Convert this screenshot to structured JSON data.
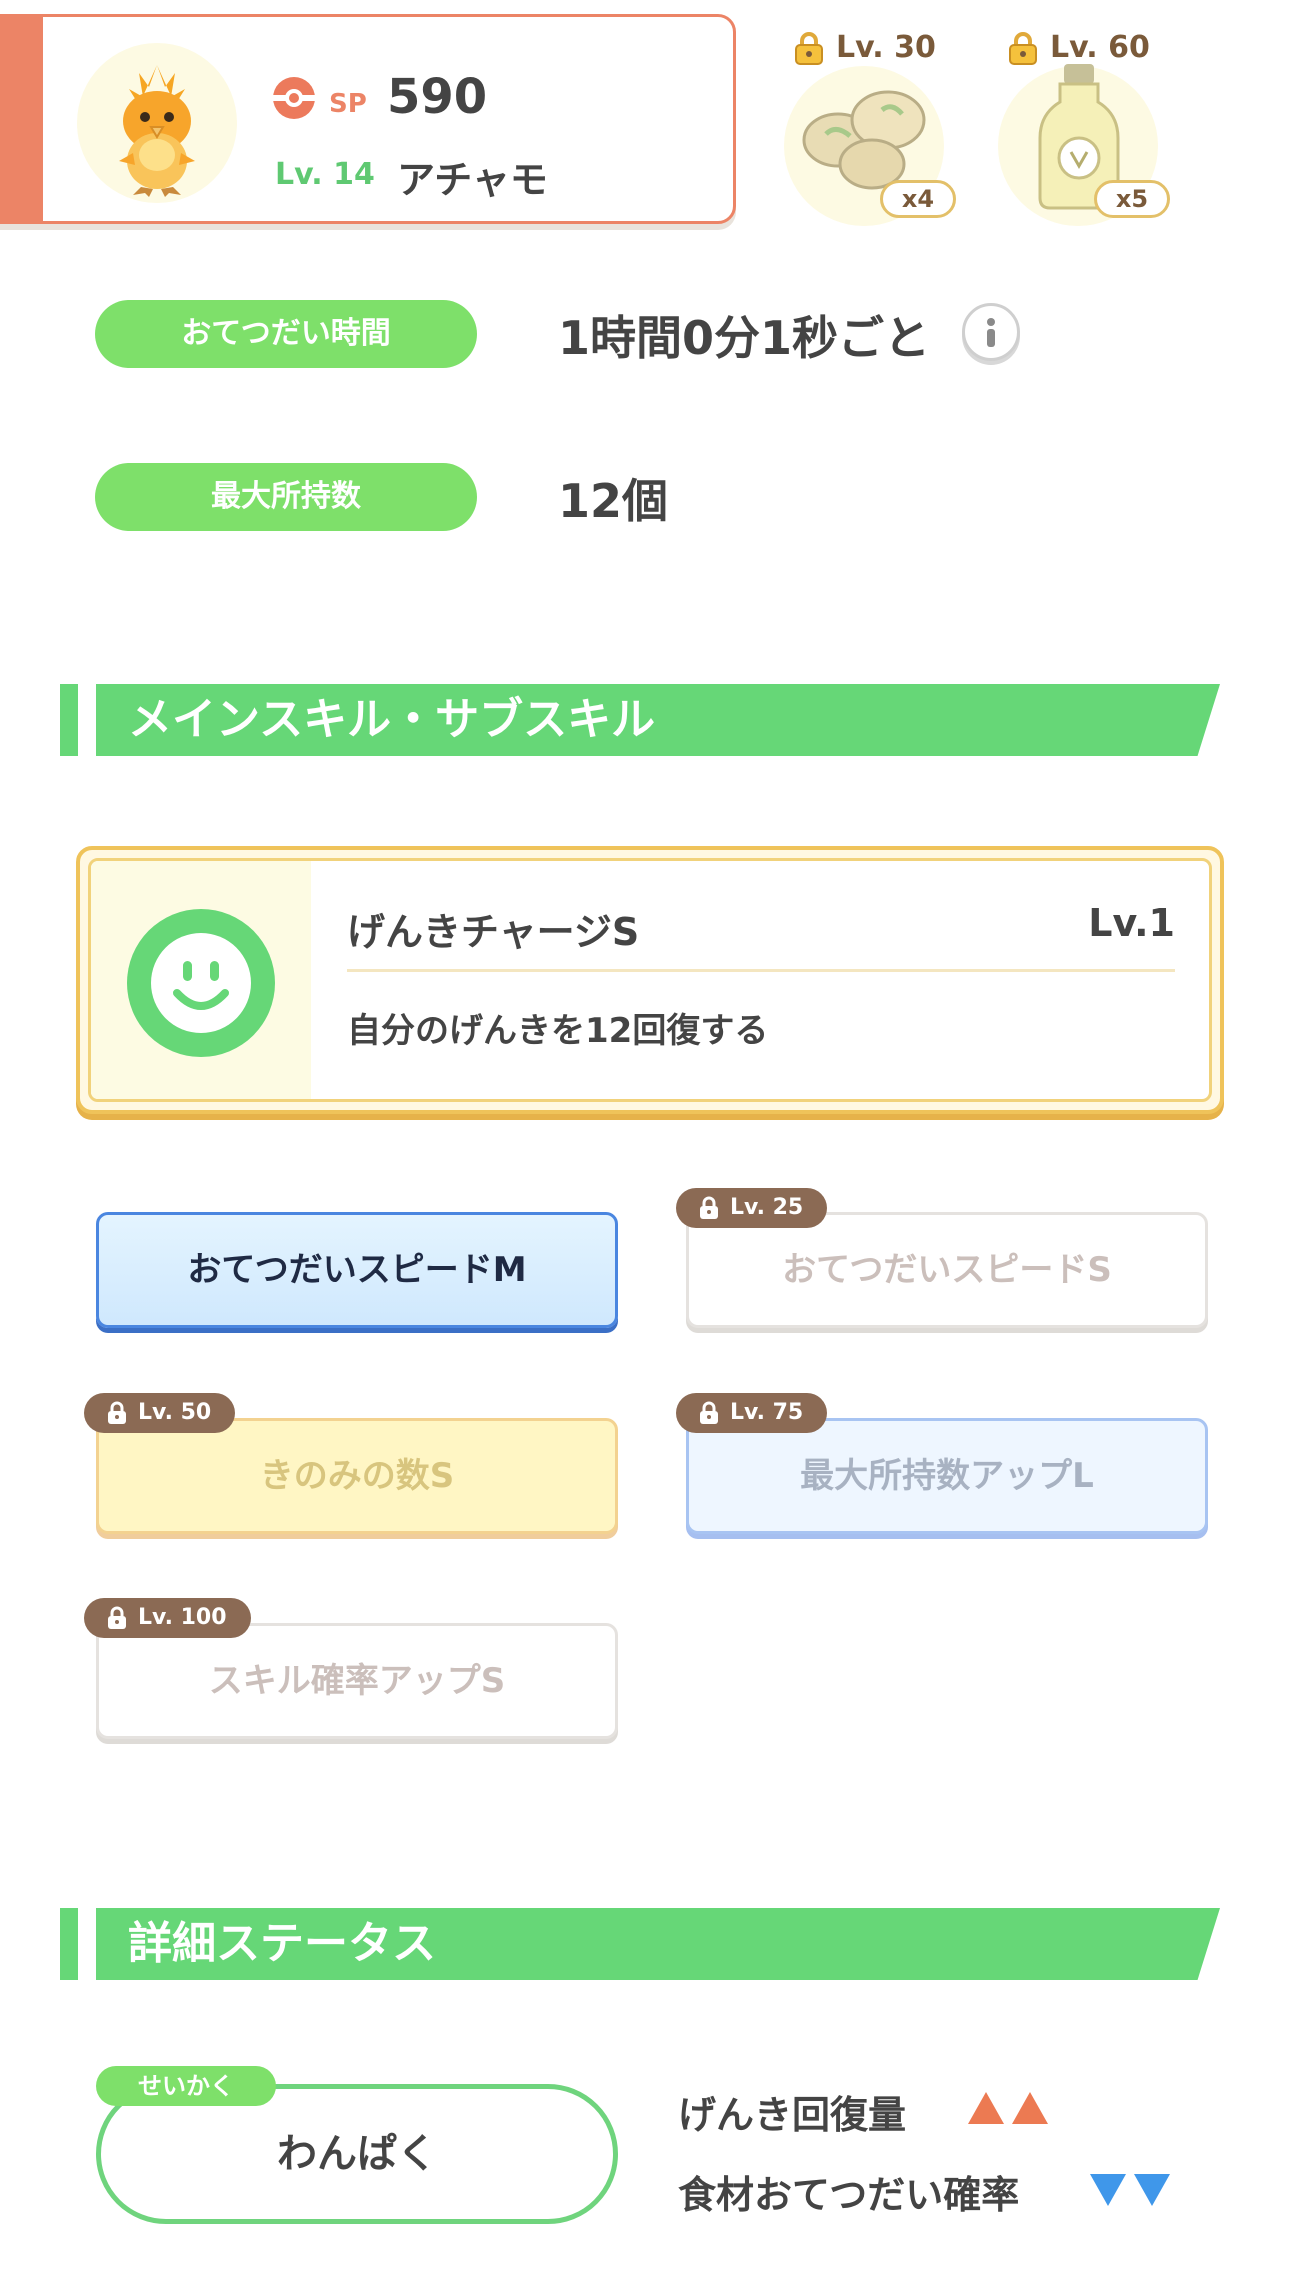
{
  "pokemon": {
    "sp_label": "SP",
    "sp_value": "590",
    "level": "Lv. 14",
    "name": "アチャモ"
  },
  "ingredients": [
    {
      "unlock": "Lv. 30",
      "quantity": "x4",
      "icon": "bean-icon"
    },
    {
      "unlock": "Lv. 60",
      "quantity": "x5",
      "icon": "oil-bottle-icon"
    }
  ],
  "info": {
    "help_time_label": "おてつだい時間",
    "help_time_value": "1時間0分1秒ごと",
    "max_carry_label": "最大所持数",
    "max_carry_value": "12個"
  },
  "sections": {
    "skills_title": "メインスキル・サブスキル",
    "status_title": "詳細ステータス"
  },
  "main_skill": {
    "name": "げんきチャージS",
    "level": "Lv.1",
    "description": "自分のげんきを12回復する"
  },
  "sub_skills": [
    {
      "label": "おてつだいスピードM",
      "lock": ""
    },
    {
      "label": "おてつだいスピードS",
      "lock": "Lv. 25"
    },
    {
      "label": "きのみの数S",
      "lock": "Lv. 50"
    },
    {
      "label": "最大所持数アップL",
      "lock": "Lv. 75"
    },
    {
      "label": "スキル確率アップS",
      "lock": "Lv. 100"
    }
  ],
  "nature": {
    "tag": "せいかく",
    "value": "わんぱく",
    "up_stat": "げんき回復量",
    "down_stat": "食材おてつだい確率"
  },
  "colors": {
    "accent_green": "#66d777",
    "accent_orange": "#ec8466",
    "up_color": "#ec7a52",
    "down_color": "#3f97ea"
  }
}
